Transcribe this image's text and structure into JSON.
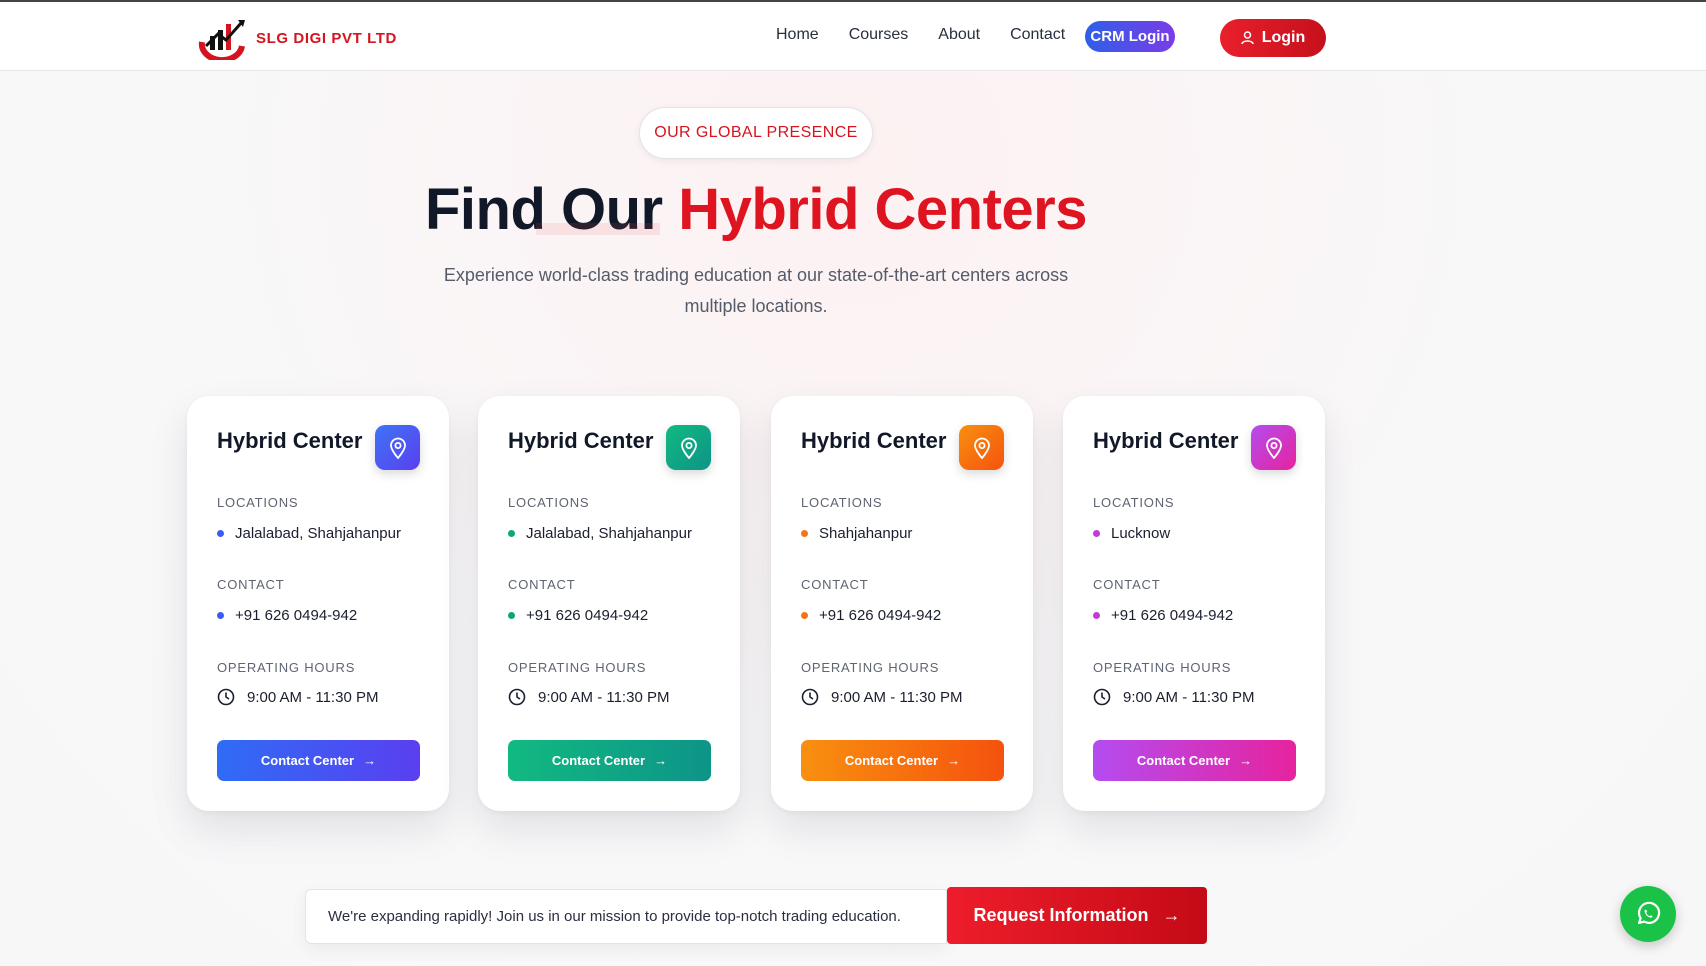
{
  "brand": {
    "name": "SLG DIGI PVT LTD",
    "color": "#d4141e"
  },
  "nav": {
    "links": [
      "Home",
      "Courses",
      "About",
      "Contact"
    ],
    "crm_label": "CRM Login",
    "login_label": "Login"
  },
  "hero": {
    "badge": "OUR GLOBAL PRESENCE",
    "title_part1": "Find Our",
    "title_part2": "Hybrid Centers",
    "subtitle": "Experience world-class trading education at our state-of-the-art centers across multiple locations."
  },
  "labels": {
    "locations": "LOCATIONS",
    "contact": "CONTACT",
    "hours": "OPERATING HOURS"
  },
  "cards": [
    {
      "title": "Hybrid Center",
      "location": "Jalalabad, Shahjahanpur",
      "phone": "+91 626 0494-942",
      "hours": "9:00 AM - 11:30 PM",
      "button": "Contact Center",
      "accent": "#3b5bf6",
      "gradient_from": "#2f6cf5",
      "gradient_to": "#5a3ff0"
    },
    {
      "title": "Hybrid Center",
      "location": "Jalalabad, Shahjahanpur",
      "phone": "+91 626 0494-942",
      "hours": "9:00 AM - 11:30 PM",
      "button": "Contact Center",
      "accent": "#0fa57a",
      "gradient_from": "#12b981",
      "gradient_to": "#0d9488"
    },
    {
      "title": "Hybrid Center",
      "location": "Shahjahanpur",
      "phone": "+91 626 0494-942",
      "hours": "9:00 AM - 11:30 PM",
      "button": "Contact Center",
      "accent": "#f97316",
      "gradient_from": "#f8900f",
      "gradient_to": "#f5520e"
    },
    {
      "title": "Hybrid Center",
      "location": "Lucknow",
      "phone": "+91 626 0494-942",
      "hours": "9:00 AM - 11:30 PM",
      "button": "Contact Center",
      "accent": "#c53ad6",
      "gradient_from": "#b44cf0",
      "gradient_to": "#e6239e"
    }
  ],
  "footer_cta": {
    "note": "We're expanding rapidly! Join us in our mission to provide top-notch trading education.",
    "button": "Request Information"
  },
  "icons": [
    "map-pin-icon",
    "clock-icon",
    "arrow-right-icon",
    "user-icon",
    "whatsapp-icon"
  ]
}
